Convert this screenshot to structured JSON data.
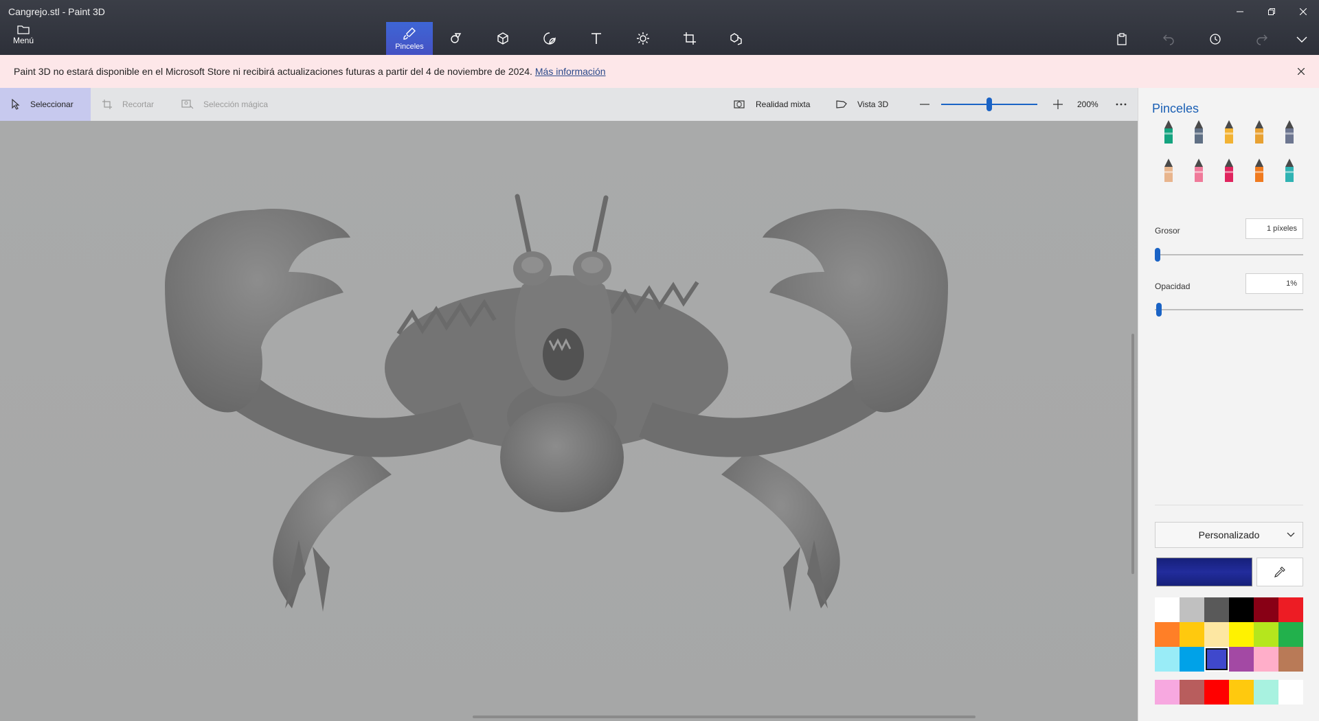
{
  "window": {
    "title": "Cangrejo.stl - Paint 3D",
    "menu_label": "Menú"
  },
  "ribbon": {
    "tools": [
      {
        "name": "brushes",
        "label": "Pinceles",
        "active": true
      },
      {
        "name": "2d-shapes",
        "label": "",
        "active": false
      },
      {
        "name": "3d-shapes",
        "label": "",
        "active": false
      },
      {
        "name": "stickers",
        "label": "",
        "active": false
      },
      {
        "name": "text",
        "label": "",
        "active": false
      },
      {
        "name": "effects",
        "label": "",
        "active": false
      },
      {
        "name": "canvas",
        "label": "",
        "active": false
      },
      {
        "name": "3d-library",
        "label": "",
        "active": false
      }
    ]
  },
  "banner": {
    "message": "Paint 3D no estará disponible en el Microsoft Store ni recibirá actualizaciones futuras a partir del 4 de noviembre de 2024.",
    "link": "Más información"
  },
  "commandbar": {
    "select": "Seleccionar",
    "crop": "Recortar",
    "magic_select": "Selección mágica",
    "mixed_reality": "Realidad mixta",
    "view_3d": "Vista 3D",
    "zoom": "200%",
    "zoom_slider_fraction": 0.5
  },
  "panel": {
    "title": "Pinceles",
    "brushes": [
      {
        "name": "marker",
        "color": "#14a37f"
      },
      {
        "name": "calligraphy-pen",
        "color": "#5f6f84"
      },
      {
        "name": "oil-brush",
        "color": "#f2b233"
      },
      {
        "name": "watercolor",
        "color": "#e8a132"
      },
      {
        "name": "pixel-pen",
        "color": "#6d7690"
      },
      {
        "name": "pencil",
        "color": "#e8b58d"
      },
      {
        "name": "eraser",
        "color": "#f07a9a"
      },
      {
        "name": "crayon",
        "color": "#e0245e"
      },
      {
        "name": "spray-can",
        "color": "#f07a1e"
      },
      {
        "name": "fill",
        "color": "#2fb3b3"
      }
    ],
    "thickness_label": "Grosor",
    "thickness_value": "1 píxeles",
    "thickness_fraction": 0,
    "opacity_label": "Opacidad",
    "opacity_value": "1%",
    "opacity_fraction": 0.01,
    "palette_label": "Personalizado",
    "current_color": "#222c9c",
    "swatches": [
      "#ffffff",
      "#c0c0c0",
      "#595959",
      "#000000",
      "#880015",
      "#ed1c24",
      "#ff7f27",
      "#ffc90e",
      "#fde7a2",
      "#fff200",
      "#b5e61d",
      "#22b14c",
      "#99ecf7",
      "#00a2e8",
      "#3f48cc",
      "#a349a4",
      "#ffaec9",
      "#b97a57"
    ],
    "selected_swatch": 14,
    "custom_swatches": [
      "#f7a8e0",
      "#b85d5d",
      "#ff0000",
      "#ffc90e",
      "#a8f2e0",
      "#ffffff"
    ]
  }
}
